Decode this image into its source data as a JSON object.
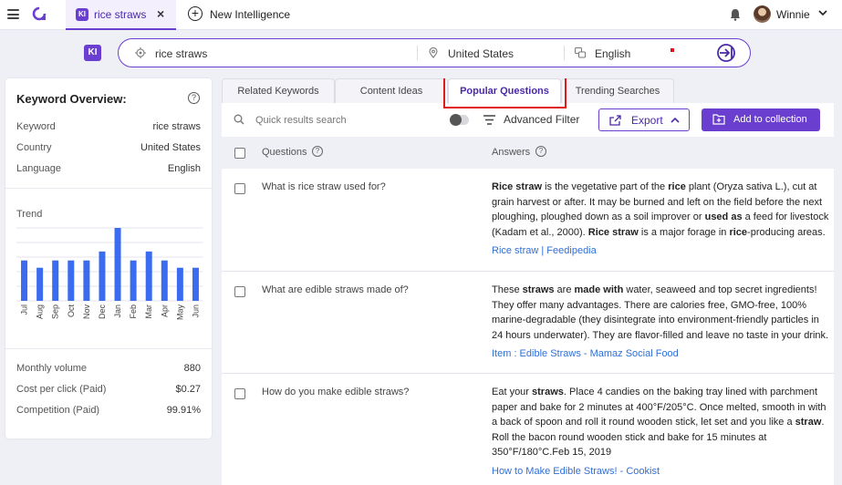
{
  "topbar": {
    "tab_badge": "KI",
    "tab_label": "rice straws",
    "tab_close": "×",
    "new_intel_label": "New Intelligence",
    "user_name": "Winnie"
  },
  "search": {
    "badge": "KI",
    "keyword": "rice straws",
    "country": "United States",
    "language": "English"
  },
  "overview": {
    "title": "Keyword Overview:",
    "rows": [
      {
        "label": "Keyword",
        "value": "rice straws"
      },
      {
        "label": "Country",
        "value": "United States"
      },
      {
        "label": "Language",
        "value": "English"
      }
    ],
    "trend_label": "Trend",
    "metrics": [
      {
        "label": "Monthly volume",
        "value": "880"
      },
      {
        "label": "Cost per click (Paid)",
        "value": "$0.27"
      },
      {
        "label": "Competition (Paid)",
        "value": "99.91%"
      }
    ]
  },
  "chart_data": {
    "type": "bar",
    "categories": [
      "Jul",
      "Aug",
      "Sep",
      "Oct",
      "Nov",
      "Dec",
      "Jan",
      "Feb",
      "Mar",
      "Apr",
      "May",
      "Jun"
    ],
    "values": [
      720,
      590,
      720,
      720,
      720,
      880,
      1300,
      720,
      880,
      720,
      590,
      590
    ],
    "ylim": [
      0,
      1300
    ],
    "color": "#3b6cf0",
    "grid": true
  },
  "tabs": [
    {
      "label": "Related Keywords"
    },
    {
      "label": "Content Ideas"
    },
    {
      "label": "Popular Questions"
    },
    {
      "label": "Trending Searches"
    }
  ],
  "toolbar": {
    "search_placeholder": "Quick results search",
    "filter_label": "Advanced Filter",
    "export_label": "Export",
    "add_label": "Add to collection"
  },
  "table": {
    "col_questions": "Questions",
    "col_answers": "Answers"
  },
  "questions": [
    {
      "question": "What is rice straw used for?",
      "link": "Rice straw | Feedipedia"
    },
    {
      "question": "What are edible straws made of?",
      "link": "Item : Edible Straws - Mamaz Social Food"
    },
    {
      "question": "How do you make edible straws?",
      "link": "How to Make Edible Straws! - Cookist"
    }
  ],
  "answers": {
    "a1": {
      "p1": "Rice straw",
      "p2": " is the vegetative part of the ",
      "p3": "rice",
      "p4": " plant (Oryza sativa L.), cut at grain harvest or after. It may be burned and left on the field before the next ploughing, ploughed down as a soil improver or ",
      "p5": "used as",
      "p6": " a feed for livestock (Kadam et al., 2000). ",
      "p7": "Rice straw",
      "p8": " is a major forage in ",
      "p9": "rice",
      "p10": "-producing areas."
    },
    "a2": {
      "p1": "These ",
      "p2": "straws",
      "p3": " are ",
      "p4": "made with",
      "p5": " water, seaweed and top secret ingredients! They offer many advantages. There are calories free, GMO-free, 100% marine-degradable (they disintegrate into environment-friendly particles in 24 hours underwater). They are flavor-filled and leave no taste in your drink."
    },
    "a3": {
      "p1": "Eat your ",
      "p2": "straws",
      "p3": ". Place 4 candies on the baking tray lined with parchment paper and bake for 2 minutes at 400°F/205°C. Once melted, smooth in with a back of spoon and roll it round wooden stick, let set and you like a ",
      "p4": "straw",
      "p5": ". Roll the bacon round wooden stick and bake for 15 minutes at 350°F/180°C.Feb 15, 2019"
    }
  }
}
